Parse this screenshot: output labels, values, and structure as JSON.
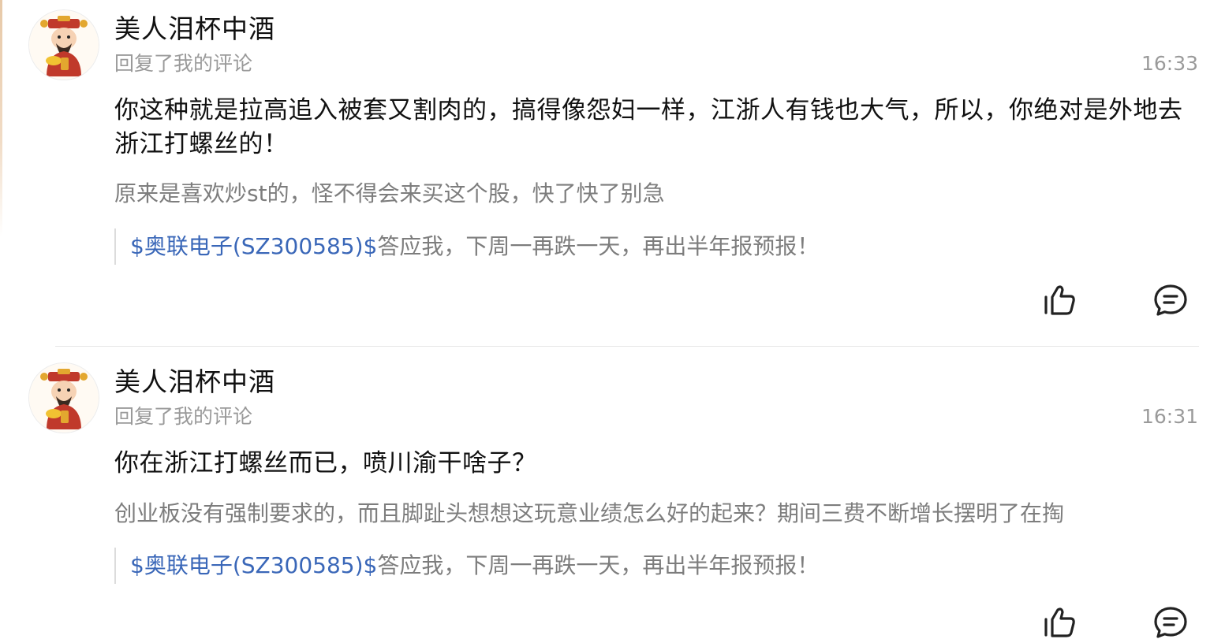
{
  "notifications": [
    {
      "author": "美人泪杯中酒",
      "action": "回复了我的评论",
      "time": "16:33",
      "reply": "你这种就是拉高追入被套又割肉的，搞得像怨妇一样，江浙人有钱也大气，所以，你绝对是外地去浙江打螺丝的！",
      "quoted": "原来是喜欢炒st的，怪不得会来买这个股，快了快了别急",
      "source_stock": "$奥联电子(SZ300585)$",
      "source_text": "答应我，下周一再跌一天，再出半年报预报！",
      "icons": [
        "thumbs-up-icon",
        "comment-icon"
      ]
    },
    {
      "author": "美人泪杯中酒",
      "action": "回复了我的评论",
      "time": "16:31",
      "reply": "你在浙江打螺丝而已，喷川渝干啥子？",
      "quoted": "创业板没有强制要求的，而且脚趾头想想这玩意业绩怎么好的起来？期间三费不断增长摆明了在掏",
      "source_stock": "$奥联电子(SZ300585)$",
      "source_text": "答应我，下周一再跌一天，再出半年报预报！",
      "icons": [
        "thumbs-up-icon",
        "comment-icon"
      ]
    }
  ],
  "colors": {
    "text_primary": "#111111",
    "text_secondary": "#9a9a9a",
    "quote_text": "#7d7d7d",
    "stock_link": "#3a67b8",
    "divider": "#e7e7e7"
  }
}
